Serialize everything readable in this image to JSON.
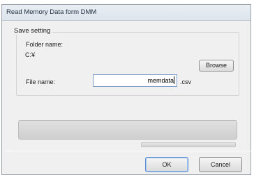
{
  "window": {
    "title": "Read Memory Data form DMM"
  },
  "save_setting": {
    "group_label": "Save setting",
    "folder_label": "Folder name:",
    "folder_value": "C:¥",
    "browse_label": "Browse",
    "file_label": "File name:",
    "file_value": "memdata",
    "extension": ".csv"
  },
  "progress": {
    "overall": 0,
    "current": 0
  },
  "buttons": {
    "ok": "OK",
    "cancel": "Cancel"
  },
  "colors": {
    "progress_fill": "#7fbf4d",
    "focus_border": "#5b8ed0"
  }
}
